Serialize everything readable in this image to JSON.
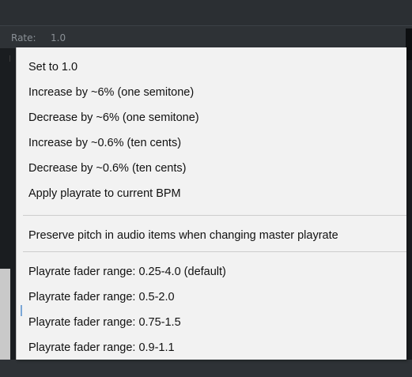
{
  "rate": {
    "label": "Rate:",
    "value": "1.0"
  },
  "menu": {
    "items": [
      "Set to 1.0",
      "Increase by ~6% (one semitone)",
      "Decrease by ~6% (one semitone)",
      "Increase by ~0.6% (ten cents)",
      "Decrease by ~0.6% (ten cents)",
      "Apply playrate to current BPM",
      "Preserve pitch in audio items when changing master playrate",
      "Playrate fader range: 0.25-4.0 (default)",
      "Playrate fader range: 0.5-2.0",
      "Playrate fader range: 0.75-1.5",
      "Playrate fader range: 0.9-1.1"
    ]
  }
}
